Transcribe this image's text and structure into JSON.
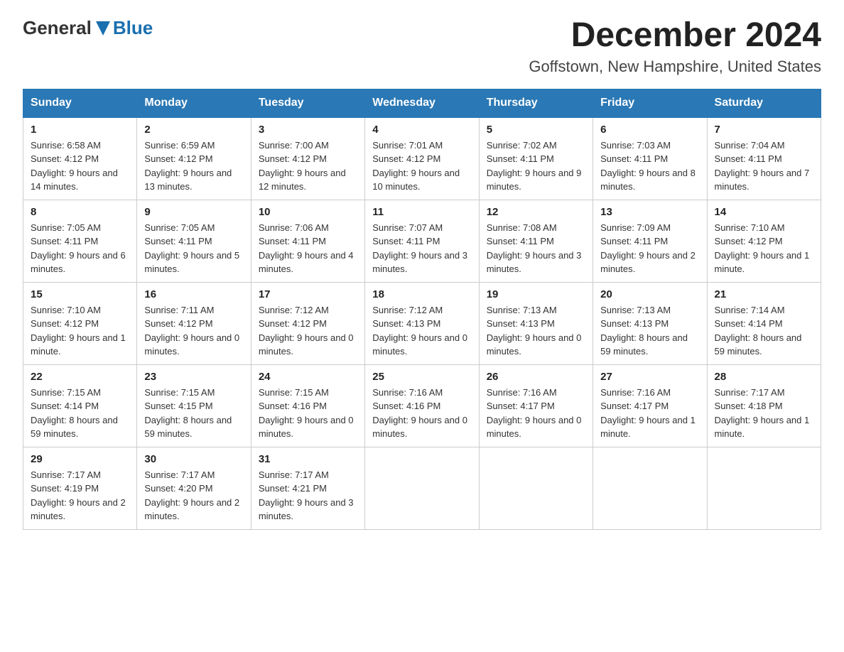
{
  "header": {
    "logo_general": "General",
    "logo_blue": "Blue",
    "month_title": "December 2024",
    "location": "Goffstown, New Hampshire, United States"
  },
  "weekdays": [
    "Sunday",
    "Monday",
    "Tuesday",
    "Wednesday",
    "Thursday",
    "Friday",
    "Saturday"
  ],
  "weeks": [
    [
      {
        "date": "1",
        "sunrise": "6:58 AM",
        "sunset": "4:12 PM",
        "daylight": "9 hours and 14 minutes."
      },
      {
        "date": "2",
        "sunrise": "6:59 AM",
        "sunset": "4:12 PM",
        "daylight": "9 hours and 13 minutes."
      },
      {
        "date": "3",
        "sunrise": "7:00 AM",
        "sunset": "4:12 PM",
        "daylight": "9 hours and 12 minutes."
      },
      {
        "date": "4",
        "sunrise": "7:01 AM",
        "sunset": "4:12 PM",
        "daylight": "9 hours and 10 minutes."
      },
      {
        "date": "5",
        "sunrise": "7:02 AM",
        "sunset": "4:11 PM",
        "daylight": "9 hours and 9 minutes."
      },
      {
        "date": "6",
        "sunrise": "7:03 AM",
        "sunset": "4:11 PM",
        "daylight": "9 hours and 8 minutes."
      },
      {
        "date": "7",
        "sunrise": "7:04 AM",
        "sunset": "4:11 PM",
        "daylight": "9 hours and 7 minutes."
      }
    ],
    [
      {
        "date": "8",
        "sunrise": "7:05 AM",
        "sunset": "4:11 PM",
        "daylight": "9 hours and 6 minutes."
      },
      {
        "date": "9",
        "sunrise": "7:05 AM",
        "sunset": "4:11 PM",
        "daylight": "9 hours and 5 minutes."
      },
      {
        "date": "10",
        "sunrise": "7:06 AM",
        "sunset": "4:11 PM",
        "daylight": "9 hours and 4 minutes."
      },
      {
        "date": "11",
        "sunrise": "7:07 AM",
        "sunset": "4:11 PM",
        "daylight": "9 hours and 3 minutes."
      },
      {
        "date": "12",
        "sunrise": "7:08 AM",
        "sunset": "4:11 PM",
        "daylight": "9 hours and 3 minutes."
      },
      {
        "date": "13",
        "sunrise": "7:09 AM",
        "sunset": "4:11 PM",
        "daylight": "9 hours and 2 minutes."
      },
      {
        "date": "14",
        "sunrise": "7:10 AM",
        "sunset": "4:12 PM",
        "daylight": "9 hours and 1 minute."
      }
    ],
    [
      {
        "date": "15",
        "sunrise": "7:10 AM",
        "sunset": "4:12 PM",
        "daylight": "9 hours and 1 minute."
      },
      {
        "date": "16",
        "sunrise": "7:11 AM",
        "sunset": "4:12 PM",
        "daylight": "9 hours and 0 minutes."
      },
      {
        "date": "17",
        "sunrise": "7:12 AM",
        "sunset": "4:12 PM",
        "daylight": "9 hours and 0 minutes."
      },
      {
        "date": "18",
        "sunrise": "7:12 AM",
        "sunset": "4:13 PM",
        "daylight": "9 hours and 0 minutes."
      },
      {
        "date": "19",
        "sunrise": "7:13 AM",
        "sunset": "4:13 PM",
        "daylight": "9 hours and 0 minutes."
      },
      {
        "date": "20",
        "sunrise": "7:13 AM",
        "sunset": "4:13 PM",
        "daylight": "8 hours and 59 minutes."
      },
      {
        "date": "21",
        "sunrise": "7:14 AM",
        "sunset": "4:14 PM",
        "daylight": "8 hours and 59 minutes."
      }
    ],
    [
      {
        "date": "22",
        "sunrise": "7:15 AM",
        "sunset": "4:14 PM",
        "daylight": "8 hours and 59 minutes."
      },
      {
        "date": "23",
        "sunrise": "7:15 AM",
        "sunset": "4:15 PM",
        "daylight": "8 hours and 59 minutes."
      },
      {
        "date": "24",
        "sunrise": "7:15 AM",
        "sunset": "4:16 PM",
        "daylight": "9 hours and 0 minutes."
      },
      {
        "date": "25",
        "sunrise": "7:16 AM",
        "sunset": "4:16 PM",
        "daylight": "9 hours and 0 minutes."
      },
      {
        "date": "26",
        "sunrise": "7:16 AM",
        "sunset": "4:17 PM",
        "daylight": "9 hours and 0 minutes."
      },
      {
        "date": "27",
        "sunrise": "7:16 AM",
        "sunset": "4:17 PM",
        "daylight": "9 hours and 1 minute."
      },
      {
        "date": "28",
        "sunrise": "7:17 AM",
        "sunset": "4:18 PM",
        "daylight": "9 hours and 1 minute."
      }
    ],
    [
      {
        "date": "29",
        "sunrise": "7:17 AM",
        "sunset": "4:19 PM",
        "daylight": "9 hours and 2 minutes."
      },
      {
        "date": "30",
        "sunrise": "7:17 AM",
        "sunset": "4:20 PM",
        "daylight": "9 hours and 2 minutes."
      },
      {
        "date": "31",
        "sunrise": "7:17 AM",
        "sunset": "4:21 PM",
        "daylight": "9 hours and 3 minutes."
      },
      null,
      null,
      null,
      null
    ]
  ]
}
